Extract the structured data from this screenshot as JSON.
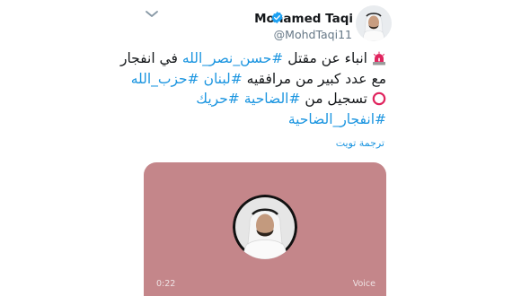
{
  "user": {
    "name": "Mohamed Taqi",
    "handle": "@MohdTaqi11"
  },
  "tweet": {
    "line1": {
      "emoji": "siren-emoji",
      "text_start": "انباء عن مقتل ",
      "hashtag": "#حسن_نصر_الله",
      "text_end": " في انفجار"
    },
    "line2": {
      "text_start": "مع عدد كبير من مرافقيه ",
      "hashtag1": "#لبنان",
      "hashtag2": "#حزب_الله"
    },
    "line3": {
      "emoji": "red-circle-emoji",
      "text_start": "تسجيل من ",
      "hashtag1": "#الضاحية",
      "hashtag2": "#حريك"
    },
    "line4": {
      "hashtag": "#انفجار_الضاحية"
    },
    "translate_label": "ترجمة تويت"
  },
  "media": {
    "duration": "0:22",
    "badge": "Voice"
  },
  "colors": {
    "link": "#1b95e0",
    "verified": "#1da1f2",
    "media_bg": "#c4868a",
    "secondary_text": "#657786"
  }
}
